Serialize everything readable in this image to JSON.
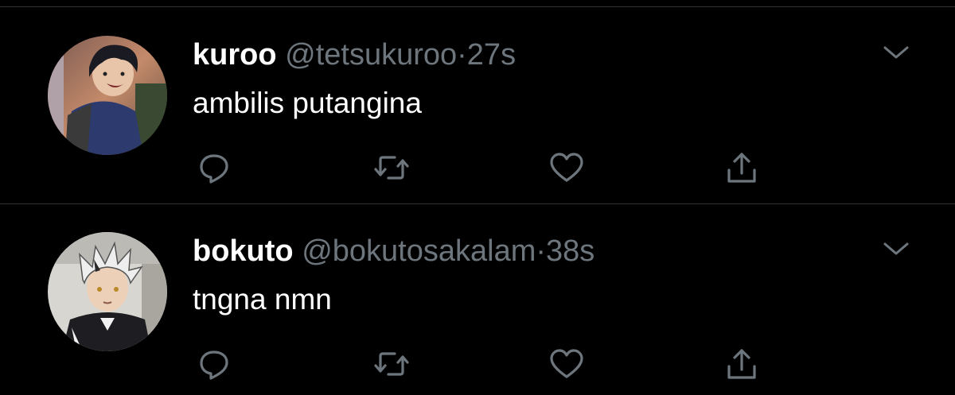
{
  "colors": {
    "background": "#000000",
    "divider": "#2f3336",
    "primary_text": "#ffffff",
    "secondary_text": "#6e767d"
  },
  "tweets": [
    {
      "display_name": "kuroo",
      "handle": "@tetsukuroo",
      "separator": "·",
      "time": "27s",
      "text": "ambilis putangina",
      "avatar_icon": "anime-avatar-dark-hair",
      "actions": [
        "reply-icon",
        "retweet-icon",
        "like-icon",
        "share-icon"
      ]
    },
    {
      "display_name": "bokuto",
      "handle": "@bokutosakalam",
      "separator": "·",
      "time": "38s",
      "text": "tngna nmn",
      "avatar_icon": "anime-avatar-grey-hair",
      "actions": [
        "reply-icon",
        "retweet-icon",
        "like-icon",
        "share-icon"
      ]
    }
  ]
}
